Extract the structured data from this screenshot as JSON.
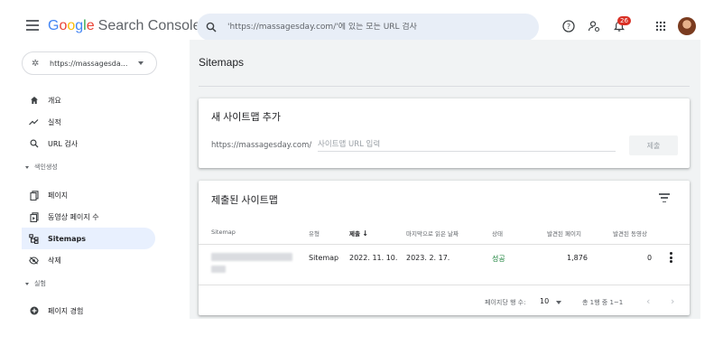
{
  "app": {
    "logo_g": "G",
    "logo_o1": "o",
    "logo_o2": "o",
    "logo_g2": "g",
    "logo_l": "l",
    "logo_e": "e",
    "product": "Search Console"
  },
  "search": {
    "placeholder": "'https://massagesday.com/'에 있는 모든 URL 검사"
  },
  "topbar": {
    "notification_count": "26"
  },
  "property": {
    "label": "https://massagesda..."
  },
  "sidebar": {
    "items": [
      {
        "label": "개요",
        "icon": "home-icon"
      },
      {
        "label": "실적",
        "icon": "trending-up-icon"
      },
      {
        "label": "URL 검사",
        "icon": "search-icon"
      }
    ],
    "section_index": "색인생성",
    "index_items": [
      {
        "label": "페이지",
        "icon": "pages-icon"
      },
      {
        "label": "동영상 페이지 수",
        "icon": "video-pages-icon"
      },
      {
        "label": "Sitemaps",
        "icon": "sitemap-icon",
        "active": true
      },
      {
        "label": "삭제",
        "icon": "removals-icon"
      }
    ],
    "section_experience": "실험",
    "experience_items": [
      {
        "label": "페이지 경험",
        "icon": "page-experience-icon"
      }
    ]
  },
  "main": {
    "title": "Sitemaps",
    "add_card": {
      "title": "새 사이트맵 추가",
      "prefix": "https://massagesday.com/",
      "placeholder": "사이트맵 URL 입력",
      "submit": "제출"
    },
    "submitted_card": {
      "title": "제출된 사이트맵",
      "columns": [
        "Sitemap",
        "유형",
        "제출",
        "마지막으로 읽은 날짜",
        "상태",
        "발견된 페이지",
        "발견된 동영상"
      ],
      "sort_arrow": "↓",
      "rows": [
        {
          "type": "Sitemap",
          "submitted": "2022. 11. 10.",
          "last_read": "2023. 2. 17.",
          "status": "성공",
          "pages": "1,876",
          "videos": "0"
        }
      ],
      "pager": {
        "rows_label": "페이지당 행 수:",
        "rows_value": "10",
        "range": "총 1행 중 1~1"
      }
    }
  },
  "colors": {
    "google_blue": "#4285f4",
    "google_red": "#ea4335",
    "google_yellow": "#fbbc05",
    "google_green": "#34a853",
    "success": "#188038",
    "active_bg": "#e8f0fe"
  }
}
